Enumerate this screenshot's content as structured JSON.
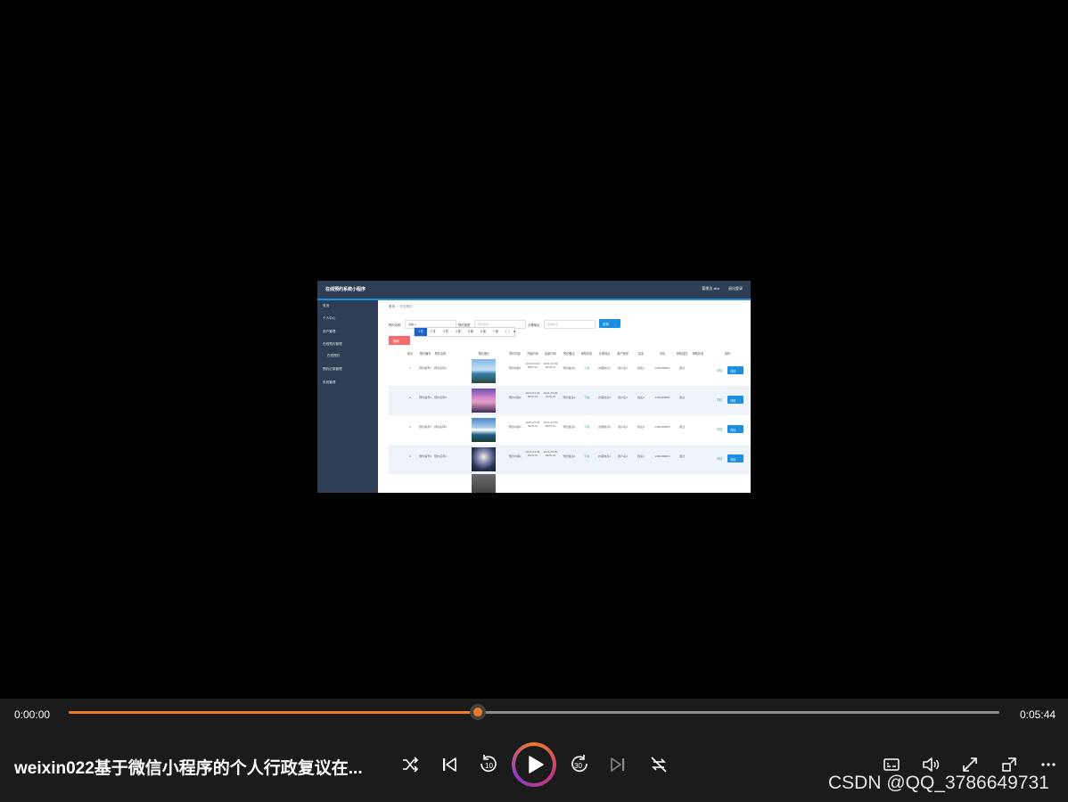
{
  "app": {
    "system_title": "在线预约系统小程序",
    "user_label": "管理员 abo",
    "logout_label": "退出登录"
  },
  "sidebar": {
    "items": [
      {
        "label": "首页"
      },
      {
        "label": "个人中心"
      },
      {
        "label": "用户管理"
      },
      {
        "label": "在线预约管理"
      },
      {
        "label": "在线预约"
      },
      {
        "label": "预约记录管理"
      },
      {
        "label": "系统管理"
      }
    ]
  },
  "breadcrumb": {
    "home": "首页",
    "current": "在线预约"
  },
  "filters": {
    "f1_label": "预约名称",
    "f1_value": "请输入",
    "f2_label": "预约类型",
    "f2_placeholder": "预约类型",
    "f3_label": "办理地点",
    "f3_placeholder": "办理地点",
    "query_label": "查询"
  },
  "ime_bar": [
    "1 在",
    "2 才",
    "3 吃",
    "4 些",
    "5 我",
    "6 成",
    "7 张",
    "〈",
    "〉",
    "⚙"
  ],
  "delete_label": "删除",
  "table": {
    "headers": [
      "索引",
      "预约编号",
      "预约名称",
      "预约图片",
      "预约内容",
      "开始时间",
      "结束时间",
      "预约备注",
      "审核状态",
      "办理地点",
      "用户账号",
      "姓名",
      "手机",
      "审核回复",
      "审核状态",
      "操作"
    ],
    "rows": [
      {
        "idx": "1",
        "no": "预约编号1",
        "name": "预约名称1",
        "content": "预约内容1",
        "start": "2021-03-09 0925-01",
        "end": "2021-03-09 0925-01",
        "note": "预约备注1",
        "status": "下载",
        "place": "办理地点1",
        "account": "用户名1",
        "uname": "姓名1",
        "phone": "1362388881",
        "reply": "通过",
        "edit": "详情",
        "btn": "详情"
      },
      {
        "idx": "2",
        "no": "预约编号2",
        "name": "预约名称2",
        "content": "预约内容2",
        "start": "2021-03-09 0925-01",
        "end": "2021-03-09 0925-01",
        "note": "预约备注2",
        "status": "下载",
        "place": "办理地点2",
        "account": "用户名2",
        "uname": "姓名2",
        "phone": "1362388882",
        "reply": "通过",
        "edit": "详情",
        "btn": "详情"
      },
      {
        "idx": "3",
        "no": "预约编号3",
        "name": "预约名称3",
        "content": "预约内容3",
        "start": "2021-03-09 0925-01",
        "end": "2021-03-09 0925-01",
        "note": "预约备注3",
        "status": "下载",
        "place": "办理地点3",
        "account": "用户名3",
        "uname": "姓名3",
        "phone": "1362388883",
        "reply": "通过",
        "edit": "详情",
        "btn": "详情"
      },
      {
        "idx": "4",
        "no": "预约编号4",
        "name": "预约名称4",
        "content": "预约内容4",
        "start": "2021-03-09 0925-01",
        "end": "2021-03-09 0925-01",
        "note": "预约备注4",
        "status": "下载",
        "place": "办理地点4",
        "account": "用户名4",
        "uname": "姓名4",
        "phone": "1362388884",
        "reply": "通过",
        "edit": "详情",
        "btn": "详情"
      }
    ]
  },
  "player": {
    "current_time": "0:00:00",
    "duration": "0:05:44",
    "progress_fraction": 0.44,
    "title": "weixin022基于微信小程序的个人行政复议在...",
    "watermark": "CSDN @QQ_3786649731",
    "accent_color": "#ef7b2a",
    "icons": [
      "shuffle-icon",
      "previous-icon",
      "rewind-10-icon",
      "play-icon",
      "forward-30-icon",
      "next-icon",
      "repeat-off-icon",
      "subtitles-icon",
      "volume-icon",
      "fullscreen-icon",
      "mini-player-icon",
      "more-icon"
    ]
  }
}
